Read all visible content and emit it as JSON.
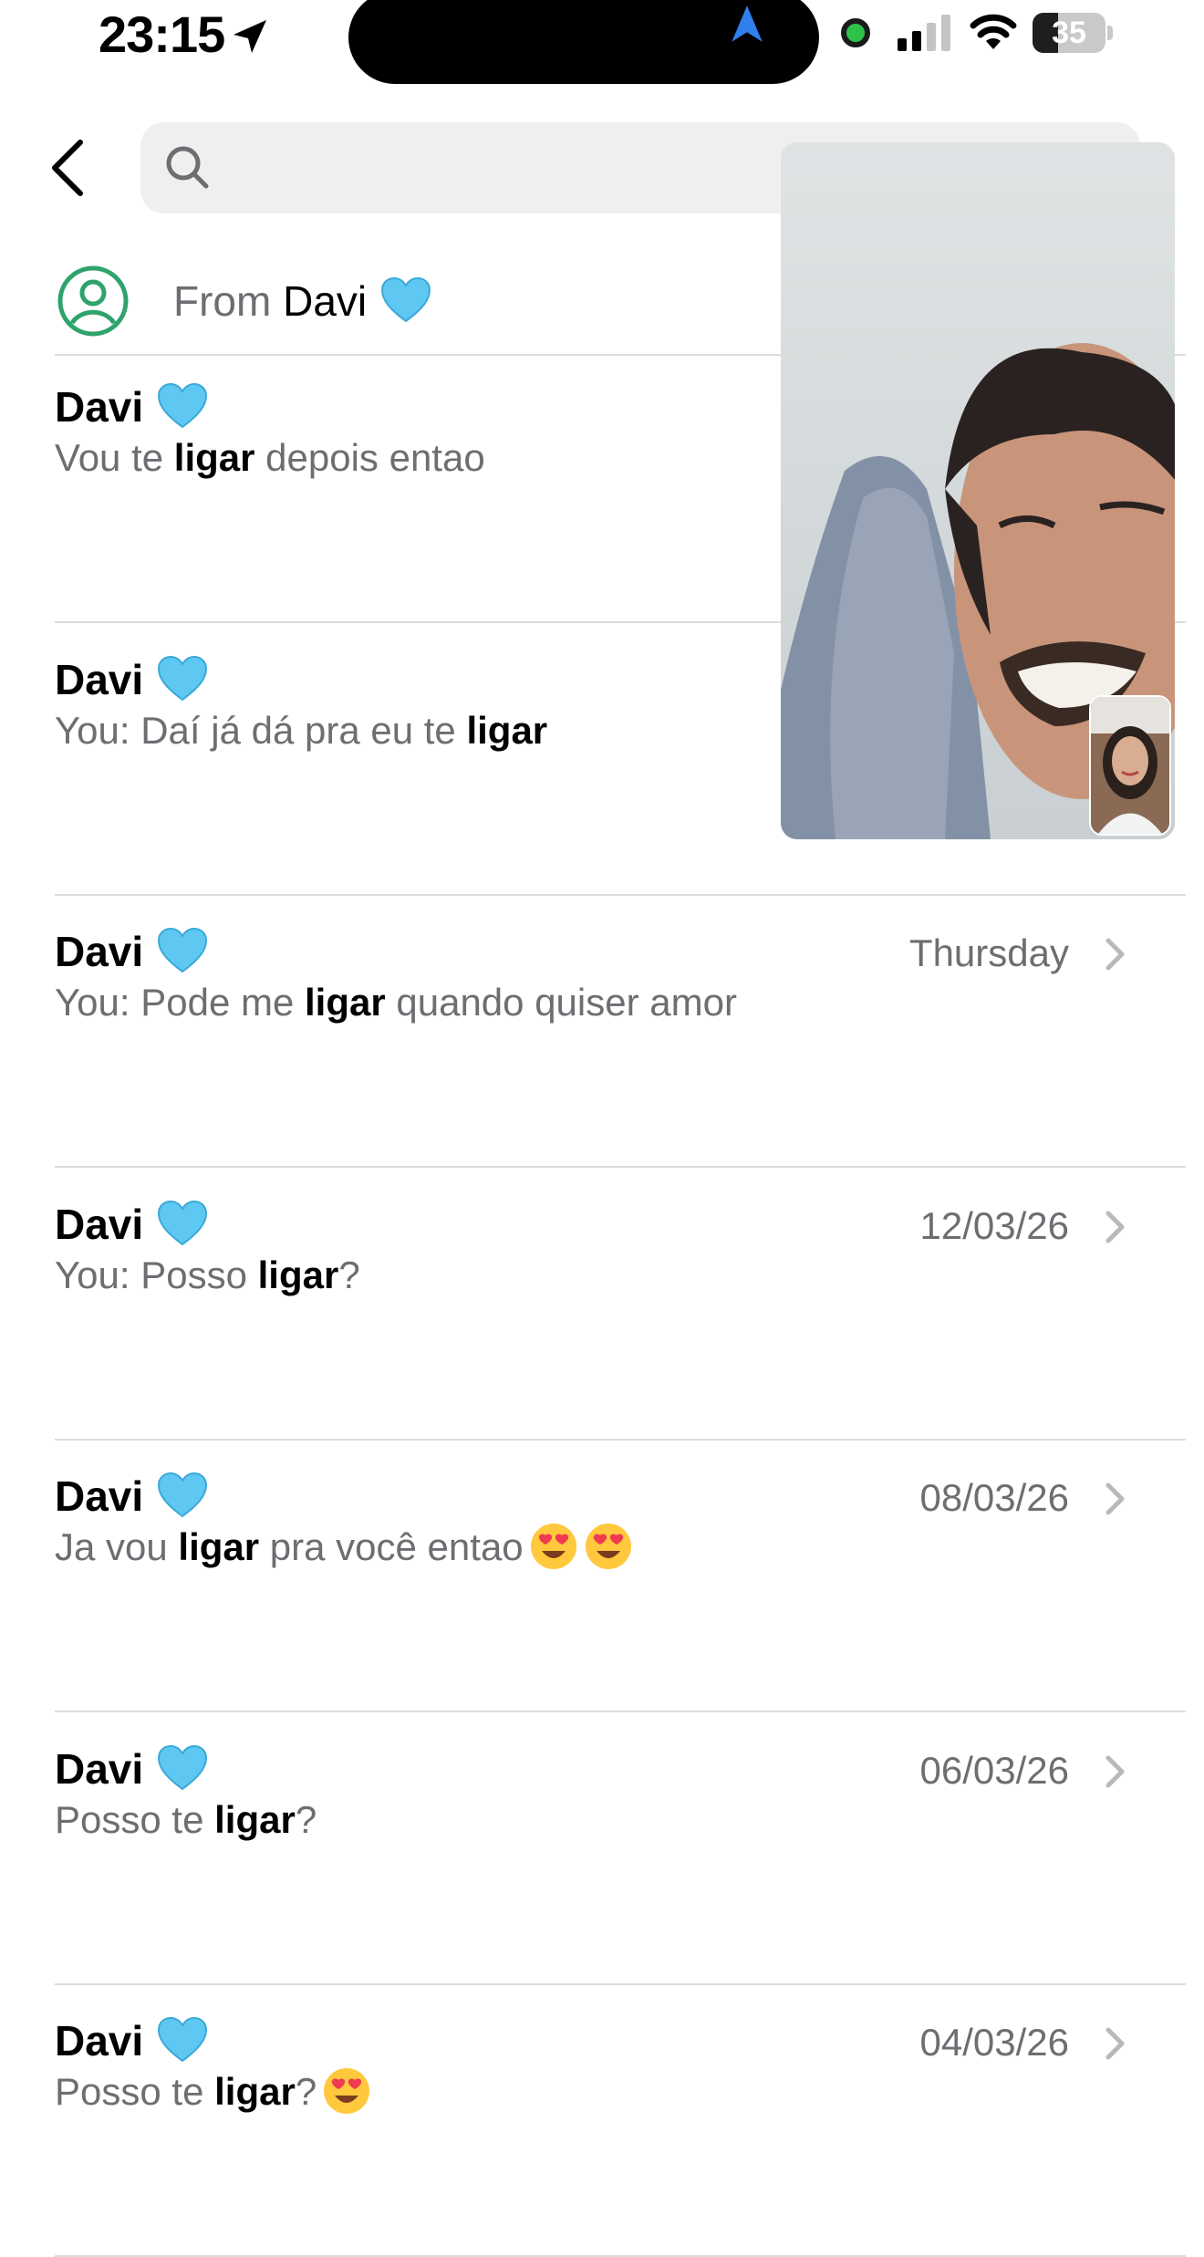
{
  "status_bar": {
    "time": "23:15",
    "battery": "35",
    "battery_level": 0.35
  },
  "search": {
    "placeholder": "",
    "value": ""
  },
  "filter": {
    "prefix": "From",
    "name": "Davi"
  },
  "results": [
    {
      "sender": "Davi",
      "date": "",
      "you": "",
      "before": "Vou te ",
      "highlight": "ligar",
      "after": " depois entao",
      "emojis": 0
    },
    {
      "sender": "Davi",
      "date": "",
      "you": "You:",
      "before": " Daí já dá pra eu te ",
      "highlight": "ligar",
      "after": "",
      "emojis": 0
    },
    {
      "sender": "Davi",
      "date": "Thursday",
      "you": "You:",
      "before": " Pode me ",
      "highlight": "ligar",
      "after": " quando quiser amor",
      "emojis": 0
    },
    {
      "sender": "Davi",
      "date": "12/03/26",
      "you": "You:",
      "before": " Posso ",
      "highlight": "ligar",
      "after": "?",
      "emojis": 0
    },
    {
      "sender": "Davi",
      "date": "08/03/26",
      "you": "",
      "before": "Ja vou ",
      "highlight": "ligar",
      "after": " pra você entao",
      "emojis": 2
    },
    {
      "sender": "Davi",
      "date": "06/03/26",
      "you": "",
      "before": "Posso te ",
      "highlight": "ligar",
      "after": "?",
      "emojis": 0
    },
    {
      "sender": "Davi",
      "date": "04/03/26",
      "you": "",
      "before": "Posso te ",
      "highlight": "ligar",
      "after": "?",
      "emojis": 1
    }
  ],
  "icons": {
    "heart": "blue-heart-icon",
    "emoji": "heart-eyes-emoji-icon",
    "chevron": "chevron-right-icon"
  },
  "colors": {
    "heart": "#5ec8f2",
    "secondary_text": "#6d6d72",
    "contact_icon": "#2ea36b",
    "nav_blue": "#2f80ed"
  }
}
